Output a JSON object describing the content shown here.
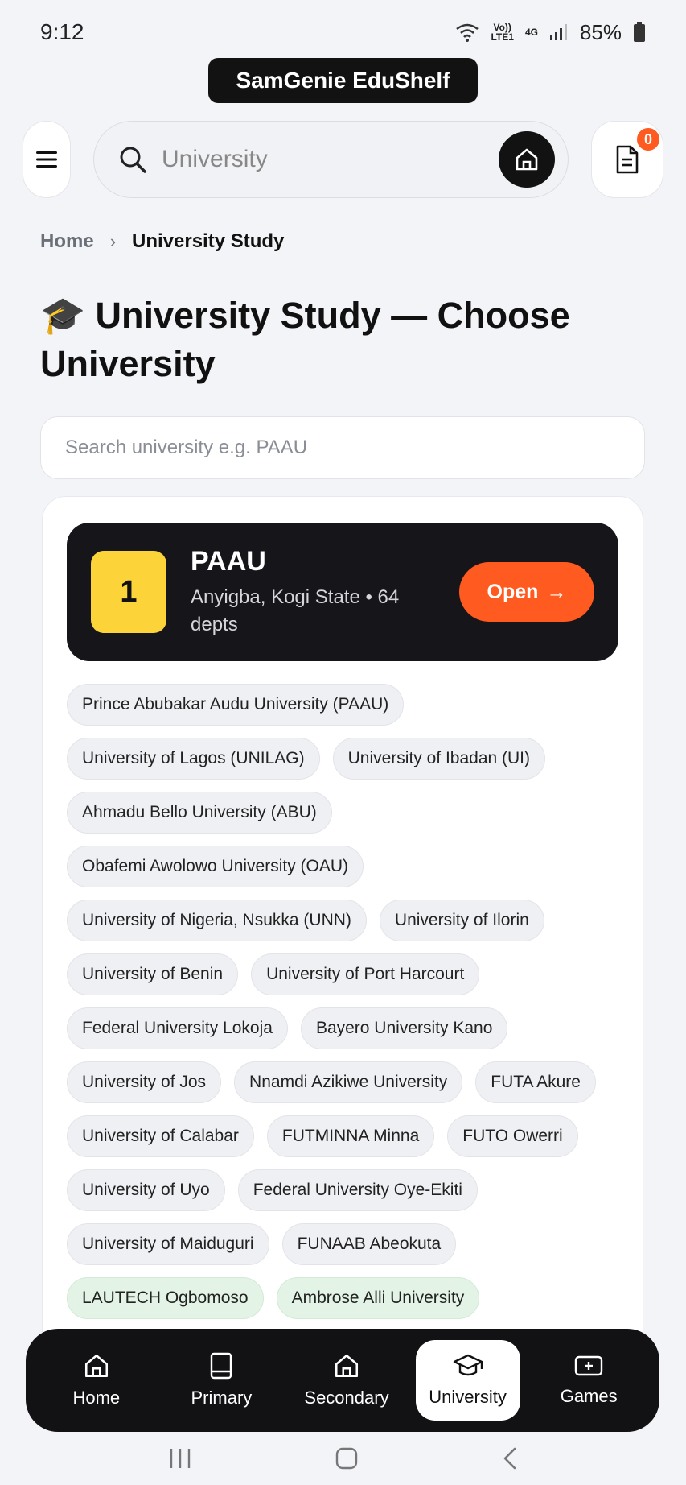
{
  "status_bar": {
    "time": "9:12",
    "volte_top": "Vo))",
    "volte_bottom": "LTE1",
    "network": "4G",
    "battery": "85%"
  },
  "app_title": "SamGenie EduShelf",
  "header": {
    "search_value": "University",
    "cart_count": "0"
  },
  "breadcrumb": {
    "home": "Home",
    "separator": "›",
    "current": "University Study"
  },
  "page_title": "🎓 University Study — Choose University",
  "uni_search": {
    "placeholder": "Search university e.g. PAAU"
  },
  "featured": {
    "rank": "1",
    "name": "PAAU",
    "subtitle": "Anyigba, Kogi State • 64 depts",
    "open_label": "Open",
    "open_arrow": "→"
  },
  "chips": [
    "Prince Abubakar Audu University (PAAU)",
    "University of Lagos (UNILAG)",
    "University of Ibadan (UI)",
    "Ahmadu Bello University (ABU)",
    "Obafemi Awolowo University (OAU)",
    "University of Nigeria, Nsukka (UNN)",
    "University of Ilorin",
    "University of Benin",
    "University of Port Harcourt",
    "Federal University Lokoja",
    "Bayero University Kano",
    "University of Jos",
    "Nnamdi Azikiwe University",
    "FUTA Akure",
    "University of Calabar",
    "FUTMINNA Minna",
    "FUTO Owerri",
    "University of Uyo",
    "Federal University Oye-Ekiti",
    "University of Maiduguri",
    "FUNAAB Abeokuta",
    "LAUTECH Ogbomoso",
    "Ambrose Alli University"
  ],
  "bottom_nav": [
    {
      "label": "Home",
      "icon": "home-icon"
    },
    {
      "label": "Primary",
      "icon": "book-icon"
    },
    {
      "label": "Secondary",
      "icon": "school-icon"
    },
    {
      "label": "University",
      "icon": "graduation-cap-icon"
    },
    {
      "label": "Games",
      "icon": "game-icon"
    }
  ],
  "colors": {
    "accent": "#ff5a1f",
    "rank_badge": "#fdd33a",
    "dark": "#121212"
  }
}
